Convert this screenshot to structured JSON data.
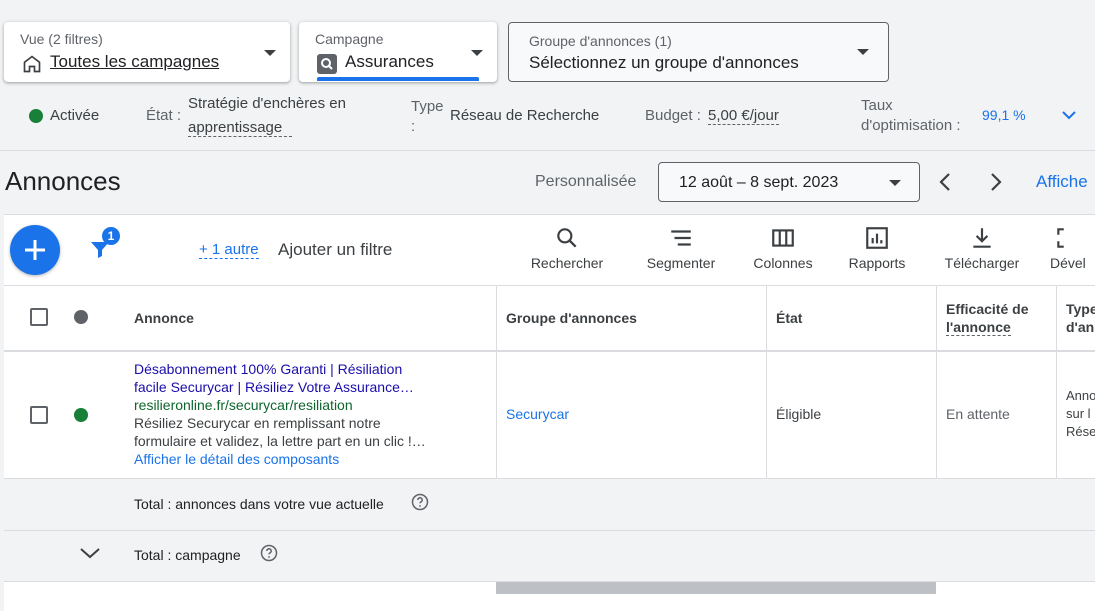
{
  "selectors": {
    "view": {
      "label": "Vue (2 filtres)",
      "value": "Toutes les campagnes"
    },
    "campaign": {
      "label": "Campagne",
      "value": "Assurances"
    },
    "adgroup": {
      "label": "Groupe d'annonces (1)",
      "value": "Sélectionnez un groupe d'annonces"
    }
  },
  "status_bar": {
    "status": "Activée",
    "state_label": "État :",
    "state_value_line1": "Stratégie d'enchères en",
    "state_value_line2": "apprentissage",
    "type_label_line1": "Type",
    "type_label_line2": ":",
    "type_value": "Réseau de Recherche",
    "budget_label": "Budget :",
    "budget_value": "5,00 €/jour",
    "opt_label_line1": "Taux",
    "opt_label_line2": "d'optimisation :",
    "opt_value": "99,1 %"
  },
  "header": {
    "title": "Annonces",
    "date_mode": "Personnalisée",
    "date_range": "12 août – 8 sept. 2023",
    "show_link": "Affiche"
  },
  "toolbar": {
    "filter_badge": "1",
    "more_filters": "+ 1 autre",
    "add_filter": "Ajouter un filtre",
    "tools": [
      "Rechercher",
      "Segmenter",
      "Colonnes",
      "Rapports",
      "Télécharger",
      "Dével"
    ]
  },
  "table": {
    "headers": {
      "ad": "Annonce",
      "adgroup": "Groupe d'annonces",
      "state": "État",
      "efficiency_line1": "Efficacité de",
      "efficiency_line2": "l'annonce",
      "type_line1": "Type",
      "type_line2": "d'an"
    },
    "row": {
      "headline1": "Désabonnement 100% Garanti | Résiliation",
      "headline2": "facile Securycar | Résiliez Votre Assurance…",
      "url": "resilieronline.fr/securycar/resiliation",
      "desc1": "Résiliez Securycar en remplissant notre",
      "desc2": "formulaire et validez, la lettre part en un clic !…",
      "details_link": "Afficher le détail des composants",
      "adgroup": "Securycar",
      "state": "Éligible",
      "efficiency": "En attente",
      "type_line1": "Anno",
      "type_line2": "sur l",
      "type_line3": "Rése"
    },
    "total_view": "Total : annonces dans votre vue actuelle",
    "total_campaign": "Total : campagne"
  },
  "colors": {
    "accent": "#1a73e8",
    "link_dark": "#1a0dab",
    "url_green": "#0d652d",
    "status_green": "#188038"
  }
}
